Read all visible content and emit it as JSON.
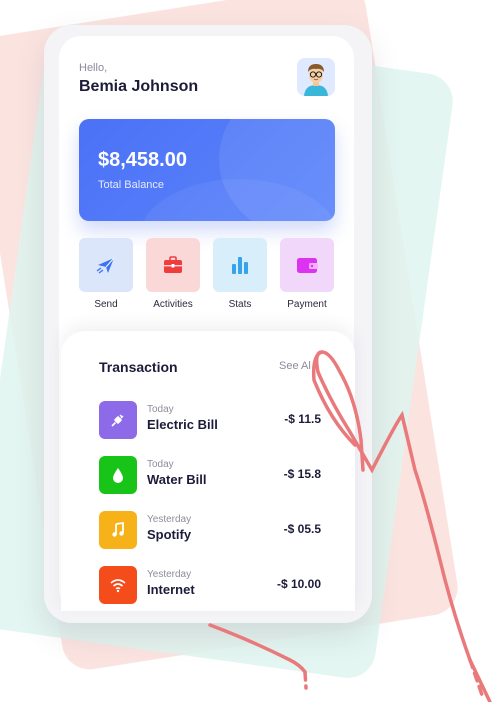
{
  "greeting": "Hello,",
  "user_name": "Bemia Johnson",
  "balance": {
    "amount": "$8,458.00",
    "label": "Total Balance"
  },
  "actions": [
    {
      "label": "Send",
      "icon": "send-icon",
      "tile_color": "#dbe6fb",
      "icon_color": "#3b73f4"
    },
    {
      "label": "Activities",
      "icon": "briefcase-icon",
      "tile_color": "#fbd8d8",
      "icon_color": "#ef3d3d"
    },
    {
      "label": "Stats",
      "icon": "bar-chart-icon",
      "tile_color": "#d9eefb",
      "icon_color": "#34a4ec"
    },
    {
      "label": "Payment",
      "icon": "wallet-icon",
      "tile_color": "#f1d8fa",
      "icon_color": "#dc33f2"
    }
  ],
  "transactions": {
    "title": "Transaction",
    "see_all": "See Al",
    "items": [
      {
        "when": "Today",
        "name": "Electric Bill",
        "amount": "-$ 11.5",
        "icon": "plug-icon",
        "color": "#8d6be8"
      },
      {
        "when": "Today",
        "name": "Water Bill",
        "amount": "-$ 15.8",
        "icon": "water-drop-icon",
        "color": "#18c418"
      },
      {
        "when": "Yesterday",
        "name": "Spotify",
        "amount": "-$ 05.5",
        "icon": "music-note-icon",
        "color": "#f7b21a"
      },
      {
        "when": "Yesterday",
        "name": "Internet",
        "amount": "-$ 10.00",
        "icon": "wifi-icon",
        "color": "#f44c1b"
      }
    ]
  }
}
